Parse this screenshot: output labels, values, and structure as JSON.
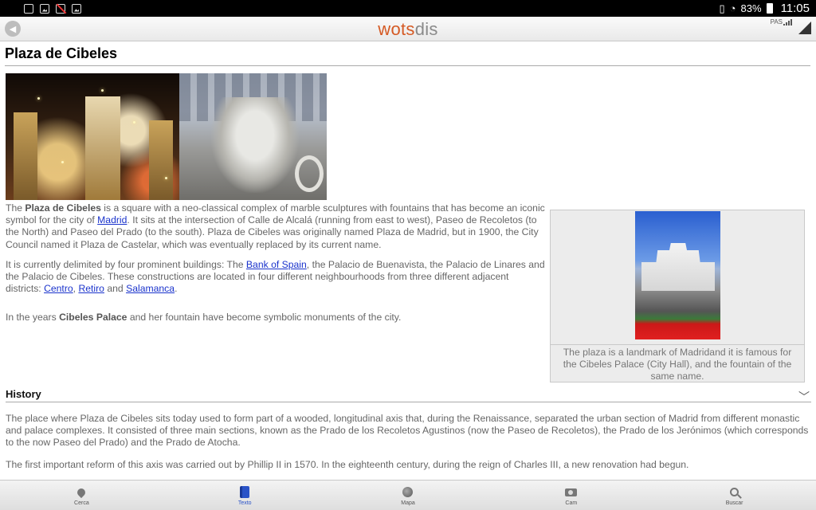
{
  "status_bar": {
    "battery": "83%",
    "time": "11:05"
  },
  "app": {
    "brand_part1": "wots",
    "brand_part2": "dis",
    "signal_label": "PAS"
  },
  "article": {
    "title": "Plaza de Cibeles",
    "p1": {
      "t1": "The ",
      "b1": "Plaza de Cibeles",
      "t2": " is a square with a neo-classical complex of marble sculptures with fountains that has become an iconic symbol for the city of ",
      "link_madrid": "Madrid",
      "t3": ". It sits at the intersection of Calle de Alcalá (running from east to west), Paseo de Recoletos (to the North) and Paseo del Prado (to the south). Plaza de Cibeles was originally named Plaza de Madrid, but in 1900, the City Council named it Plaza de Castelar, which was eventually replaced by its current name."
    },
    "p2": {
      "t1": "It is currently delimited by four prominent buildings: The ",
      "link_bank": "Bank of Spain",
      "t2": ", the Palacio de Buenavista, the Palacio de Linares and the Palacio de Cibeles. These constructions are located in four different neighbourhoods from three different adjacent districts: ",
      "link_centro": "Centro",
      "sep1": ", ",
      "link_retiro": "Retiro",
      "sep2": " and ",
      "link_salamanca": "Salamanca",
      "t3": "."
    },
    "p3": {
      "t1": "In the years ",
      "b1": "Cibeles Palace",
      "t2": " and her fountain have become symbolic monuments of the city."
    },
    "figure_caption": "The plaza is a landmark of Madridand it is famous for the Cibeles Palace (City Hall), and the fountain of the same name.",
    "section_title": "History",
    "history_p1": "The place where Plaza de Cibeles sits today used to form part of a wooded, longitudinal axis that, during the Renaissance, separated the urban section of Madrid from different monastic and palace complexes. It consisted of three main sections, known as the Prado de los Recoletos Agustinos (now the Paseo de Recoletos), the Prado de los Jerónimos (which corresponds to the now Paseo del Prado) and the Prado de Atocha.",
    "history_p2": "The first important reform of this axis was carried out by Phillip II in 1570. In the eighteenth century, during the reign of Charles III, a new renovation had begun."
  },
  "bottom_nav": [
    {
      "label": "Cerca",
      "icon": "location-pin-icon"
    },
    {
      "label": "Texto",
      "icon": "book-icon",
      "active": true
    },
    {
      "label": "Mapa",
      "icon": "globe-icon"
    },
    {
      "label": "Cam",
      "icon": "camera-icon"
    },
    {
      "label": "Buscar",
      "icon": "search-icon"
    }
  ],
  "colors": {
    "brand_orange": "#d55a24",
    "link_blue": "#1a33cc",
    "active_tab": "#2a53c7"
  }
}
